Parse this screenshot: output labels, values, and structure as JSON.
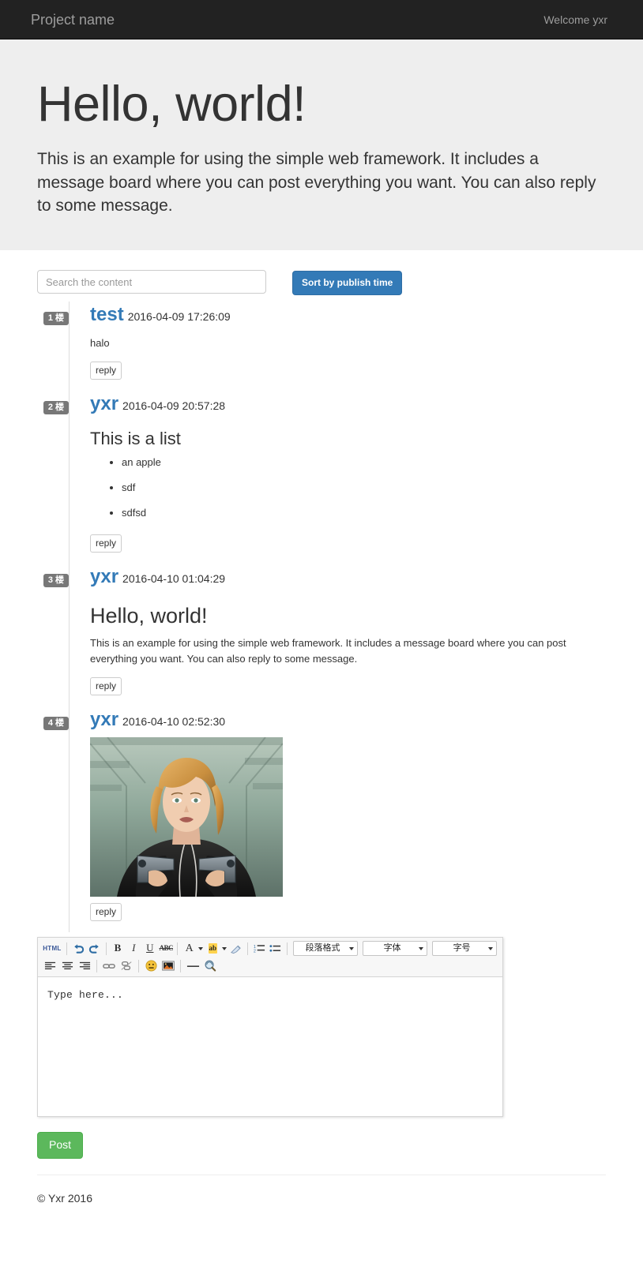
{
  "navbar": {
    "brand": "Project name",
    "welcome": "Welcome yxr"
  },
  "jumbotron": {
    "title": "Hello, world!",
    "description": "This is an example for using the simple web framework. It includes a message board where you can post everything you want. You can also reply to some message."
  },
  "search": {
    "placeholder": "Search the content",
    "value": "",
    "sort_button": "Sort by publish time"
  },
  "posts": [
    {
      "floor": "1 楼",
      "author": "test",
      "time": "2016-04-09 17:26:09",
      "body_text": "halo",
      "reply_label": "reply"
    },
    {
      "floor": "2 楼",
      "author": "yxr",
      "time": "2016-04-09 20:57:28",
      "heading": "This is a list",
      "list": [
        "an apple",
        "sdf",
        "sdfsd"
      ],
      "reply_label": "reply"
    },
    {
      "floor": "3 楼",
      "author": "yxr",
      "time": "2016-04-10 01:04:29",
      "heading": "Hello, world!",
      "body_text": "This is an example for using the simple web framework. It includes a message board where you can post everything you want. You can also reply to some message.",
      "reply_label": "reply"
    },
    {
      "floor": "4 楼",
      "author": "yxr",
      "time": "2016-04-10 02:52:30",
      "image_alt": "woman-with-two-handguns-photo",
      "reply_label": "reply"
    }
  ],
  "editor": {
    "placeholder": "Type here...",
    "toolbar_row1": [
      {
        "name": "html-source-icon",
        "label": "HTML"
      },
      {
        "name": "undo-icon",
        "label": "↶"
      },
      {
        "name": "redo-icon",
        "label": "↷"
      },
      {
        "name": "bold-icon",
        "label": "B"
      },
      {
        "name": "italic-icon",
        "label": "I"
      },
      {
        "name": "underline-icon",
        "label": "U"
      },
      {
        "name": "strikethrough-icon",
        "label": "ABC"
      },
      {
        "name": "font-color-icon",
        "label": "A"
      },
      {
        "name": "text-highlight-icon",
        "label": "ab"
      },
      {
        "name": "clear-format-icon",
        "label": "✐"
      },
      {
        "name": "ordered-list-icon",
        "label": "1."
      },
      {
        "name": "unordered-list-icon",
        "label": "•"
      }
    ],
    "dropdowns": [
      {
        "name": "paragraph-format-select",
        "label": "段落格式"
      },
      {
        "name": "font-family-select",
        "label": "字体"
      },
      {
        "name": "font-size-select",
        "label": "字号"
      }
    ],
    "toolbar_row2": [
      {
        "name": "align-left-icon",
        "label": "≡"
      },
      {
        "name": "align-center-icon",
        "label": "≡"
      },
      {
        "name": "align-right-icon",
        "label": "≡"
      },
      {
        "name": "insert-link-icon",
        "label": "🔗"
      },
      {
        "name": "remove-link-icon",
        "label": "⛓"
      },
      {
        "name": "insert-emoji-icon",
        "label": "☺"
      },
      {
        "name": "insert-image-icon",
        "label": "▣"
      },
      {
        "name": "horizontal-rule-icon",
        "label": "—"
      },
      {
        "name": "preview-search-icon",
        "label": "🔍"
      }
    ],
    "post_button": "Post"
  },
  "footer": {
    "copyright": "© Yxr 2016"
  },
  "colors": {
    "navbar_bg": "#222222",
    "jumbotron_bg": "#eeeeee",
    "primary": "#337ab7",
    "success": "#5cb85c",
    "badge": "#777777"
  }
}
